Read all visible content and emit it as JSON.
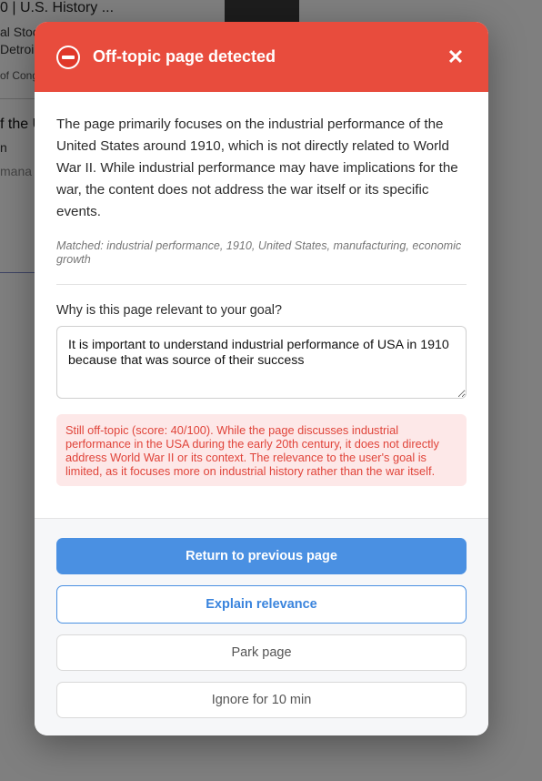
{
  "background": {
    "title_fragment": "0 | U.S. History ...",
    "fragments": [
      "al Stoc",
      "Detroi",
      "of Cong",
      "f the U",
      "n",
      "mana"
    ]
  },
  "modal": {
    "title": "Off-topic page detected",
    "header_color": "#e84c3d",
    "icon": "stop-icon",
    "close_symbol": "✕",
    "description": "The page primarily focuses on the industrial performance of the United States around 1910, which is not directly related to World War II. While industrial performance may have implications for the war, the content does not address the war itself or its specific events.",
    "matched": "Matched: industrial performance, 1910, United States, manufacturing, economic growth",
    "question": "Why is this page relevant to your goal?",
    "answer": "It is important to understand industrial performance of USA in 1910 because that was source of their success",
    "warning": "Still off-topic (score: 40/100). While the page discusses industrial performance in the USA during the early 20th century, it does not directly address World War II or its context. The relevance to the user's goal is limited, as it focuses more on industrial history rather than the war itself.",
    "buttons": {
      "return": "Return to previous page",
      "explain": "Explain relevance",
      "park": "Park page",
      "ignore": "Ignore for 10 min"
    },
    "accent_color": "#4a90e2"
  }
}
